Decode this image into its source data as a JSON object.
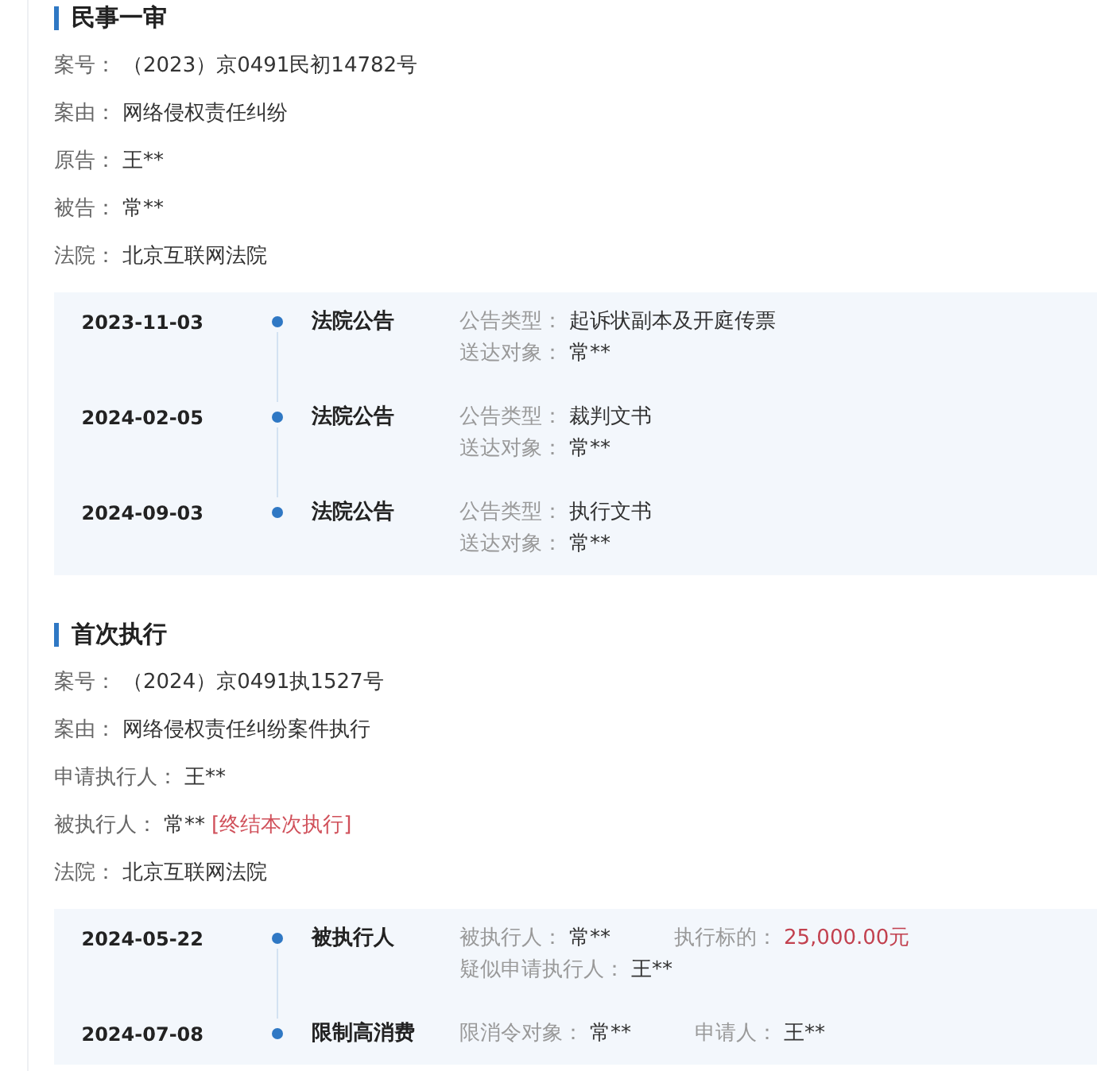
{
  "sections": [
    {
      "title": "民事一审",
      "fields": [
        {
          "label": "案号：",
          "value": "（2023）京0491民初14782号"
        },
        {
          "label": "案由：",
          "value": "网络侵权责任纠纷"
        },
        {
          "label": "原告：",
          "value": "王**"
        },
        {
          "label": "被告：",
          "value": "常**"
        },
        {
          "label": "法院：",
          "value": "北京互联网法院"
        }
      ],
      "timeline": [
        {
          "date": "2023-11-03",
          "title": "法院公告",
          "lines": [
            [
              {
                "label": "公告类型：",
                "value": "起诉状副本及开庭传票",
                "kind": "text"
              }
            ],
            [
              {
                "label": "送达对象：",
                "value": "常**",
                "kind": "text"
              }
            ]
          ]
        },
        {
          "date": "2024-02-05",
          "title": "法院公告",
          "lines": [
            [
              {
                "label": "公告类型：",
                "value": "裁判文书",
                "kind": "text"
              }
            ],
            [
              {
                "label": "送达对象：",
                "value": "常**",
                "kind": "text"
              }
            ]
          ]
        },
        {
          "date": "2024-09-03",
          "title": "法院公告",
          "lines": [
            [
              {
                "label": "公告类型：",
                "value": "执行文书",
                "kind": "text"
              }
            ],
            [
              {
                "label": "送达对象：",
                "value": "常**",
                "kind": "text"
              }
            ]
          ]
        }
      ]
    },
    {
      "title": "首次执行",
      "fields": [
        {
          "label": "案号：",
          "value": "（2024）京0491执1527号"
        },
        {
          "label": "案由：",
          "value": "网络侵权责任纠纷案件执行"
        },
        {
          "label": "申请执行人：",
          "value": "王**"
        },
        {
          "label": "被执行人：",
          "value": "常**",
          "status_tag": "[终结本次执行]"
        },
        {
          "label": "法院：",
          "value": "北京互联网法院"
        }
      ],
      "timeline": [
        {
          "date": "2024-05-22",
          "title": "被执行人",
          "lines": [
            [
              {
                "label": "被执行人：",
                "value": "常**",
                "kind": "text"
              },
              {
                "label": "执行标的：",
                "value": "25,000.00元",
                "kind": "amount"
              }
            ],
            [
              {
                "label": "疑似申请执行人：",
                "value": "王**",
                "kind": "text"
              }
            ]
          ]
        },
        {
          "date": "2024-07-08",
          "title": "限制高消费",
          "lines": [
            [
              {
                "label": "限消令对象：",
                "value": "常**",
                "kind": "text"
              },
              {
                "label": "申请人：",
                "value": "王**",
                "kind": "text"
              }
            ]
          ]
        }
      ]
    }
  ]
}
